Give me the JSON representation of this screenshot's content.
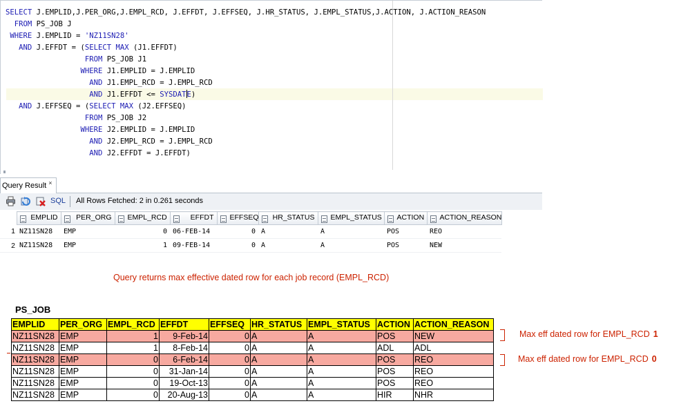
{
  "editor": {
    "lines": [
      [
        [
          "kw",
          "SELECT"
        ],
        [
          "t",
          " J.EMPLID,J.PER_ORG,J.EMPL_RCD, J.EFFDT, J.EFFSEQ, J.HR_STATUS, J.EMPL_STATUS,J.ACTION, J.ACTION_REASON"
        ]
      ],
      [
        [
          "t",
          "  "
        ],
        [
          "kw",
          "FROM"
        ],
        [
          "t",
          " PS_JOB J"
        ]
      ],
      [
        [
          "t",
          " "
        ],
        [
          "kw",
          "WHERE"
        ],
        [
          "t",
          " J.EMPLID = "
        ],
        [
          "str",
          "'NZ11SN28'"
        ]
      ],
      [
        [
          "t",
          "   "
        ],
        [
          "kw",
          "AND"
        ],
        [
          "t",
          " J.EFFDT = ("
        ],
        [
          "kw",
          "SELECT"
        ],
        [
          "t",
          " "
        ],
        [
          "kw",
          "MAX"
        ],
        [
          "t",
          " (J1.EFFDT)"
        ]
      ],
      [
        [
          "t",
          "                  "
        ],
        [
          "kw",
          "FROM"
        ],
        [
          "t",
          " PS_JOB J1"
        ]
      ],
      [
        [
          "t",
          "                 "
        ],
        [
          "kw",
          "WHERE"
        ],
        [
          "t",
          " J1.EMPLID = J.EMPLID"
        ]
      ],
      [
        [
          "t",
          "                   "
        ],
        [
          "kw",
          "AND"
        ],
        [
          "t",
          " J1.EMPL_RCD = J.EMPL_RCD"
        ]
      ],
      [
        [
          "t",
          "                   "
        ],
        [
          "kw",
          "AND"
        ],
        [
          "t",
          " J1.EFFDT <= "
        ],
        [
          "kw",
          "SYSDAT"
        ],
        [
          "caret",
          ""
        ],
        [
          "kw",
          "E"
        ],
        [
          "t",
          ")"
        ]
      ],
      [
        [
          "t",
          "   "
        ],
        [
          "kw",
          "AND"
        ],
        [
          "t",
          " J.EFFSEQ = ("
        ],
        [
          "kw",
          "SELECT"
        ],
        [
          "t",
          " "
        ],
        [
          "kw",
          "MAX"
        ],
        [
          "t",
          " (J2.EFFSEQ)"
        ]
      ],
      [
        [
          "t",
          "                  "
        ],
        [
          "kw",
          "FROM"
        ],
        [
          "t",
          " PS_JOB J2"
        ]
      ],
      [
        [
          "t",
          "                 "
        ],
        [
          "kw",
          "WHERE"
        ],
        [
          "t",
          " J2.EMPLID = J.EMPLID"
        ]
      ],
      [
        [
          "t",
          "                   "
        ],
        [
          "kw",
          "AND"
        ],
        [
          "t",
          " J2.EMPL_RCD = J.EMPL_RCD"
        ]
      ],
      [
        [
          "t",
          "                   "
        ],
        [
          "kw",
          "AND"
        ],
        [
          "t",
          " J2.EFFDT = J.EFFDT)"
        ]
      ]
    ]
  },
  "result_panel": {
    "tab_label": "Query Result",
    "tab_close": "×",
    "sql_link": "SQL",
    "fetch_status": "All Rows Fetched: 2 in 0.261 seconds",
    "columns": [
      "EMPLID",
      "PER_ORG",
      "EMPL_RCD",
      "EFFDT",
      "EFFSEQ",
      "HR_STATUS",
      "EMPL_STATUS",
      "ACTION",
      "ACTION_REASON"
    ],
    "rows": [
      [
        "1",
        "NZ11SN28",
        "EMP",
        "0",
        "06-FEB-14",
        "0",
        "A",
        "A",
        "POS",
        "REO"
      ],
      [
        "2",
        "NZ11SN28",
        "EMP",
        "1",
        "09-FEB-14",
        "0",
        "A",
        "A",
        "POS",
        "NEW"
      ]
    ]
  },
  "explanation": "Query returns max effective dated row for each job record (EMPL_RCD)",
  "ps_job": {
    "title": "PS_JOB",
    "columns": [
      "EMPLID",
      "PER_ORG",
      "EMPL_RCD",
      "EFFDT",
      "EFFSEQ",
      "HR_STATUS",
      "EMPL_STATUS",
      "ACTION",
      "ACTION_REASON"
    ],
    "rows": [
      {
        "highlight": true,
        "cells": [
          "NZ11SN28",
          "EMP",
          "1",
          "9-Feb-14",
          "0",
          "A",
          "A",
          "POS",
          "NEW"
        ]
      },
      {
        "highlight": false,
        "cells": [
          "NZ11SN28",
          "EMP",
          "1",
          "8-Feb-14",
          "0",
          "A",
          "A",
          "ADL",
          "ADL"
        ]
      },
      {
        "highlight": true,
        "cells": [
          "NZ11SN28",
          "EMP",
          "0",
          "6-Feb-14",
          "0",
          "A",
          "A",
          "POS",
          "REO"
        ]
      },
      {
        "highlight": false,
        "cells": [
          "NZ11SN28",
          "EMP",
          "0",
          "31-Jan-14",
          "0",
          "A",
          "A",
          "POS",
          "REO"
        ]
      },
      {
        "highlight": false,
        "cells": [
          "NZ11SN28",
          "EMP",
          "0",
          "19-Oct-13",
          "0",
          "A",
          "A",
          "POS",
          "REO"
        ]
      },
      {
        "highlight": false,
        "cells": [
          "NZ11SN28",
          "EMP",
          "0",
          "20-Aug-13",
          "0",
          "A",
          "A",
          "HIR",
          "NHR"
        ]
      }
    ],
    "annotations": [
      {
        "text": "Max eff dated row for EMPL_RCD",
        "value": "1"
      },
      {
        "text": "Max eff dated row for EMPL_RCD",
        "value": "0"
      }
    ]
  },
  "colors": {
    "keyword": "#1b1bb3",
    "annotation": "#cc2200",
    "header_fill": "#ffff00",
    "highlight_fill": "#f7a9a0"
  }
}
